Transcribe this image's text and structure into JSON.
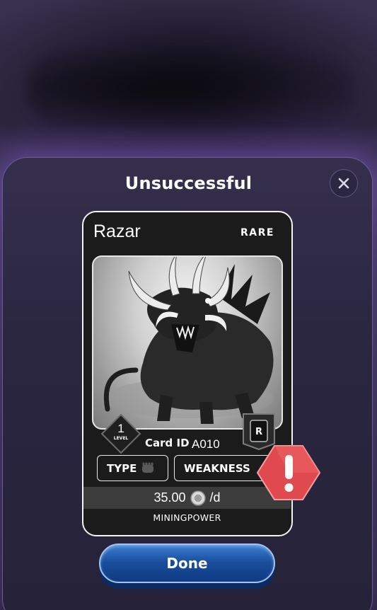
{
  "modal": {
    "title": "Unsuccessful",
    "close_icon": "close-icon"
  },
  "card": {
    "name": "Razar",
    "rarity": "RARE",
    "level": "1",
    "level_label": "LEVEL",
    "rarity_badge_letter": "R",
    "card_id_label": "Card ID",
    "card_id_value": "A010",
    "type_label": "TYPE",
    "type_icon": "fist-icon",
    "weakness_label": "WEAKNESS",
    "mining_rate_value": "35.00",
    "mining_rate_unit": "/d",
    "coin_icon": "coin-icon",
    "mining_power_label": "MININGPOWER",
    "art_subject": "boar-creature-illustration"
  },
  "warning": {
    "icon": "warning-octagon-icon",
    "color": "#e04a4f"
  },
  "actions": {
    "done_label": "Done"
  },
  "colors": {
    "primary_button": "#1a4f9e",
    "modal_border": "#6a5a9a",
    "card_background": "#1b1b1b"
  }
}
